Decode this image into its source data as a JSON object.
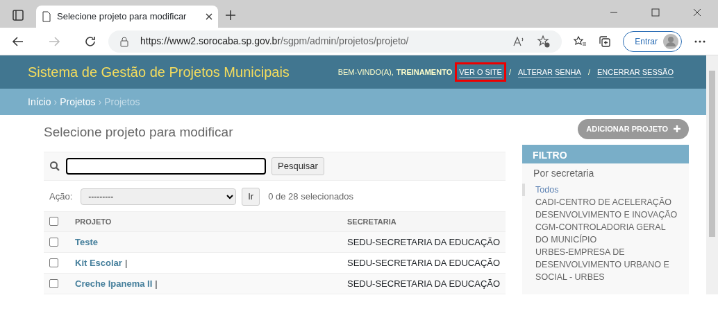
{
  "browser": {
    "tab_title": "Selecione projeto para modificar",
    "url_host": "https://www2.sorocaba.sp.gov.br",
    "url_path": "/sgpm/admin/projetos/projeto/",
    "signin_label": "Entrar"
  },
  "header": {
    "site_title": "Sistema de Gestão de Projetos Municipais",
    "welcome": "BEM-VINDO(A),",
    "user": "TREINAMENTO",
    "link_separator": "/",
    "links": [
      {
        "label": "VER O SITE",
        "highlighted": true
      },
      {
        "label": "ALTERAR SENHA",
        "highlighted": false
      },
      {
        "label": "ENCERRAR SESSÃO",
        "highlighted": false
      }
    ]
  },
  "breadcrumb_separator": "›",
  "breadcrumbs": [
    {
      "label": "Início",
      "link": true
    },
    {
      "label": "Projetos",
      "link": true
    },
    {
      "label": "Projetos",
      "link": false
    }
  ],
  "page_title": "Selecione projeto para modificar",
  "add_button": "ADICIONAR PROJETO",
  "search": {
    "button": "Pesquisar"
  },
  "actions": {
    "label": "Ação:",
    "value": "---------",
    "go": "Ir",
    "counter": "0 de 28 selecionados"
  },
  "table": {
    "select_all_checked": false,
    "columns": [
      "PROJETO",
      "SECRETARIA"
    ],
    "rows": [
      {
        "project": "Teste",
        "suffix": "",
        "secretaria": "SEDU-SECRETARIA DA EDUCAÇÃO",
        "checked": false
      },
      {
        "project": "Kit Escolar",
        "suffix": "|",
        "secretaria": "SEDU-SECRETARIA DA EDUCAÇÃO",
        "checked": false
      },
      {
        "project": "Creche Ipanema II",
        "suffix": "|",
        "secretaria": "SEDU-SECRETARIA DA EDUCAÇÃO",
        "checked": false
      }
    ]
  },
  "filter": {
    "title": "FILTRO",
    "group": "Por secretaria",
    "options": [
      {
        "label": "Todos",
        "selected": true
      },
      {
        "label": "CADI-CENTRO DE ACELERAÇÃO DESENVOLVIMENTO E INOVAÇÃO",
        "selected": false
      },
      {
        "label": "CGM-CONTROLADORIA GERAL DO MUNICÍPIO",
        "selected": false
      },
      {
        "label": "URBES-EMPRESA DE DESENVOLVIMENTO URBANO E SOCIAL - URBES",
        "selected": false
      }
    ]
  }
}
